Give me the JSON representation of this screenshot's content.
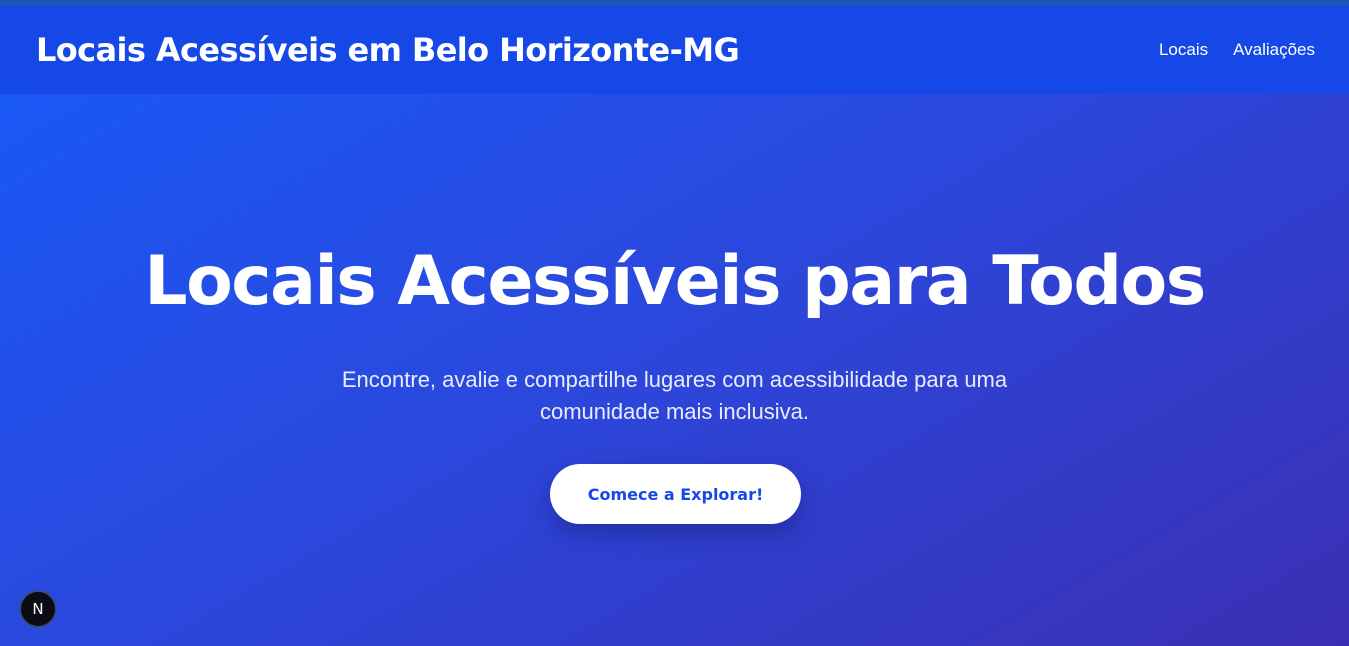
{
  "header": {
    "brand": "Locais Acessíveis em Belo Horizonte-MG",
    "nav": [
      "Locais",
      "Avaliações"
    ]
  },
  "hero": {
    "title": "Locais Acessíveis para Todos",
    "subtitle_line1": "Encontre, avalie e compartilhe lugares com acessibilidade para uma",
    "subtitle_line2": "comunidade mais inclusiva.",
    "cta_label": "Comece a Explorar!"
  },
  "dev_badge": {
    "letter": "N",
    "icon": "nextjs-icon"
  },
  "colors": {
    "header_bg": "#1648e8",
    "hero_gradient_start": "#1a58f5",
    "hero_gradient_end": "#3a2fb3",
    "cta_text": "#1648e8"
  }
}
